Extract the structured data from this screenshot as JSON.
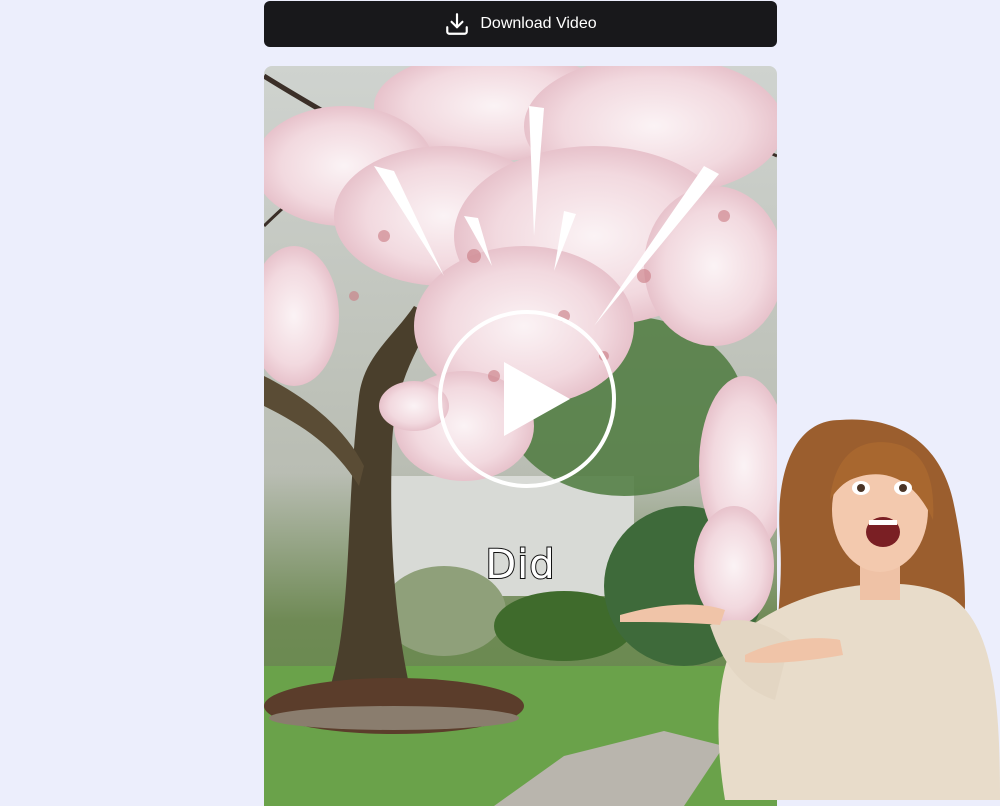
{
  "download": {
    "label": "Download Video",
    "icon": "download-icon"
  },
  "video": {
    "caption": "Did",
    "play_icon": "play-icon"
  },
  "colors": {
    "button_bg": "#18181b",
    "page_bg": "#eceefc",
    "blossom": "#f3dde2"
  }
}
